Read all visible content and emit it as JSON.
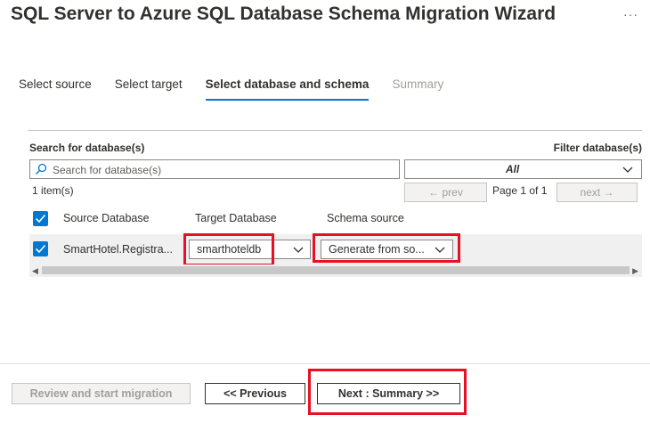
{
  "title": "SQL Server to Azure SQL Database Schema Migration Wizard",
  "more_menu": "···",
  "tabs": [
    {
      "label": "Select source",
      "state": "normal"
    },
    {
      "label": "Select target",
      "state": "normal"
    },
    {
      "label": "Select database and schema",
      "state": "active"
    },
    {
      "label": "Summary",
      "state": "disabled"
    }
  ],
  "search": {
    "label": "Search for database(s)",
    "placeholder": "Search for database(s)"
  },
  "filter": {
    "label": "Filter database(s)",
    "value": "All"
  },
  "items_count": "1 item(s)",
  "pager": {
    "prev": "← prev",
    "page_info": "Page 1 of 1",
    "next": "next →"
  },
  "table": {
    "headers": {
      "source": "Source Database",
      "target": "Target Database",
      "schema": "Schema source"
    },
    "rows": [
      {
        "checked": true,
        "source": "SmartHotel.Registra...",
        "target": "smarthoteldb",
        "schema": "Generate from so..."
      }
    ]
  },
  "footer": {
    "review_label": "Review and start migration",
    "previous_label": "<< Previous",
    "next_label": "Next : Summary >>"
  },
  "colors": {
    "accent": "#0078d4",
    "highlight": "#e81123"
  }
}
